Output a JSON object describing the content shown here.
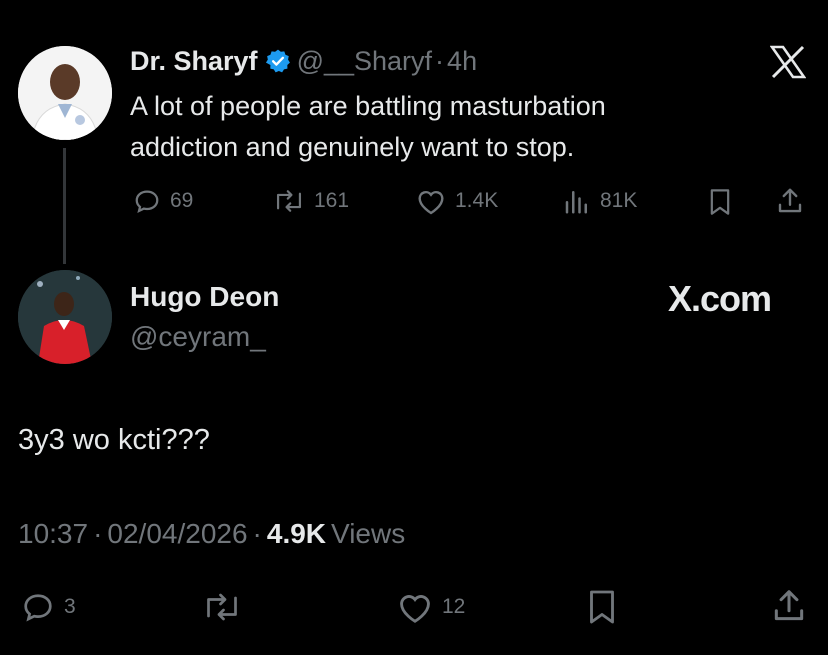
{
  "quoted": {
    "name": "Dr. Sharyf",
    "handle": "@__Sharyf",
    "separator": "·",
    "time": "4h",
    "text_line1": "A lot of people are battling masturbation",
    "text_line2": "addiction and genuinely want to stop.",
    "stats": {
      "replies": "69",
      "reposts": "161",
      "likes": "1.4K",
      "views": "81K"
    },
    "verified_color": "#1d9bf0"
  },
  "reply": {
    "name": "Hugo Deon",
    "handle": "@ceyram_",
    "text": "3y3 wo kcti???",
    "time": "10:37",
    "sep1": "·",
    "date": "02/04/2026",
    "sep2": "·",
    "views_count": "4.9K",
    "views_label": "Views",
    "stats": {
      "replies": "3",
      "likes": "12"
    }
  },
  "branding": {
    "x_logo": "X",
    "x_com": "X.com"
  },
  "icons": [
    "verified-badge-icon",
    "x-logo-icon",
    "reply-icon",
    "repost-icon",
    "like-icon",
    "views-icon",
    "bookmark-icon",
    "share-icon"
  ]
}
